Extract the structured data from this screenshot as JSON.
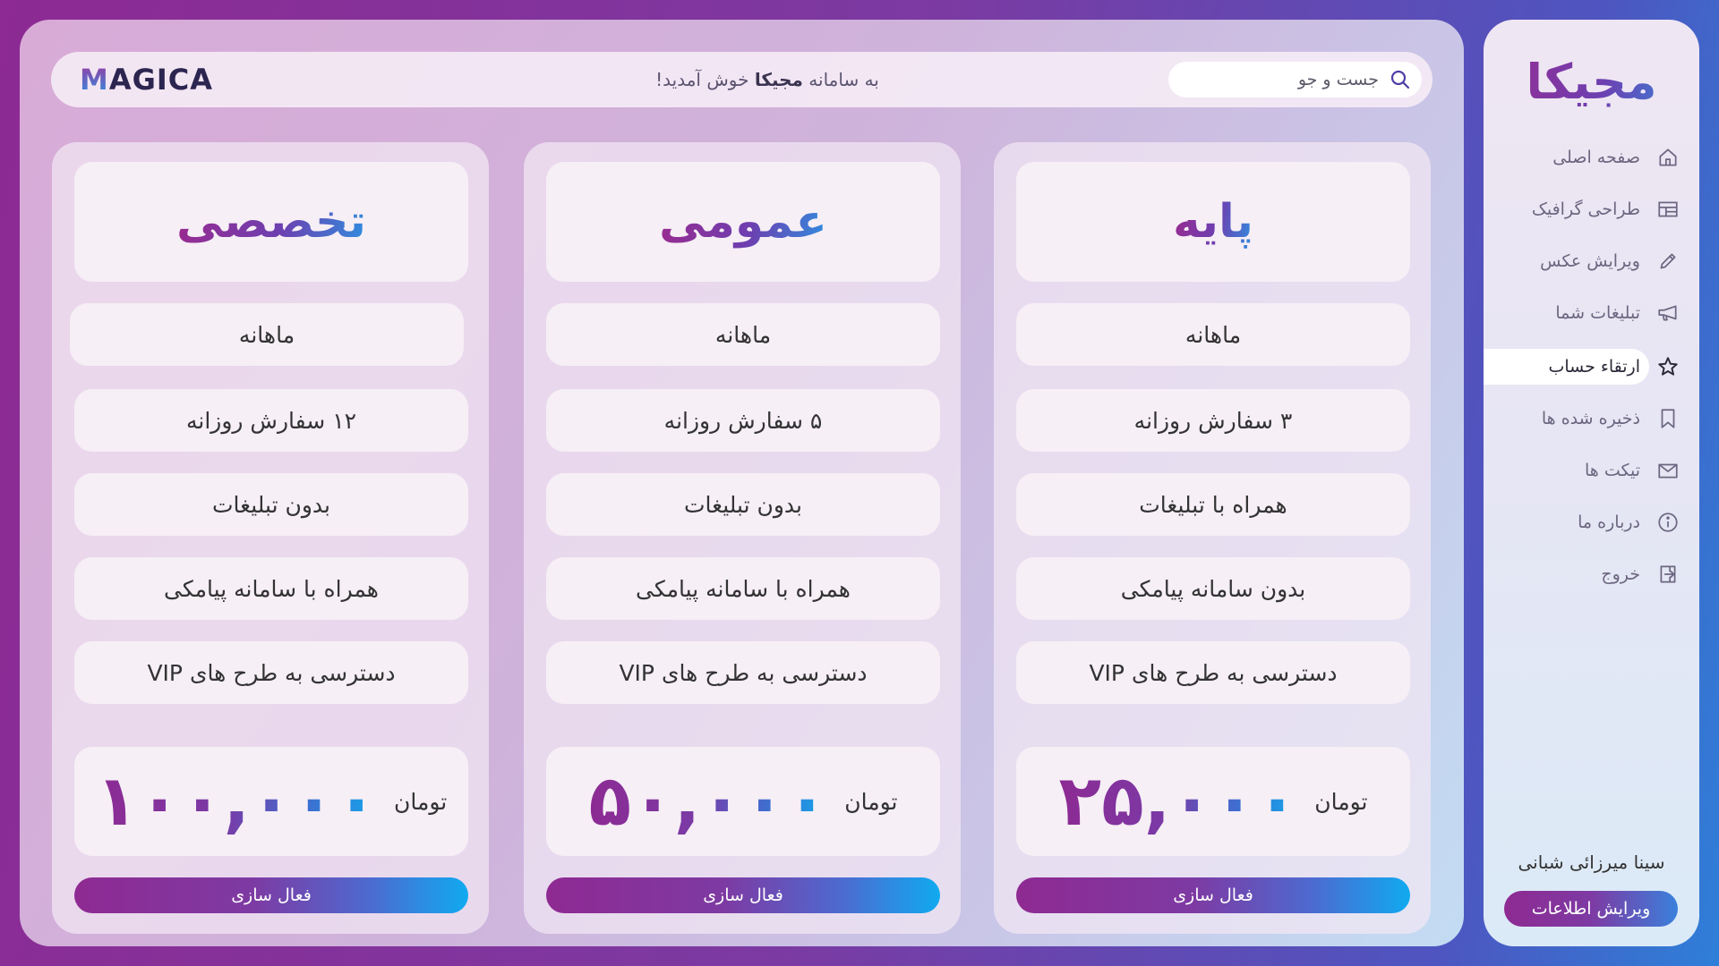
{
  "header": {
    "logo": "MAGICA",
    "welcome_prefix": "به سامانه",
    "welcome_brand": "مجیکا",
    "welcome_suffix": "خوش آمدید!",
    "search_placeholder": "جست و جو"
  },
  "plans": [
    {
      "title": "تخصصی",
      "features": [
        "ماهانه",
        "۱۲ سفارش روزانه",
        "بدون تبلیغات",
        "همراه با سامانه پیامکی",
        "دسترسی به طرح های VIP"
      ],
      "price": "۱۰۰,۰۰۰",
      "currency": "تومان",
      "button": "فعال سازی"
    },
    {
      "title": "عمومی",
      "features": [
        "ماهانه",
        "۵ سفارش روزانه",
        "بدون تبلیغات",
        "همراه با سامانه پیامکی",
        "دسترسی به طرح های VIP"
      ],
      "price": "۵۰,۰۰۰",
      "currency": "تومان",
      "button": "فعال سازی"
    },
    {
      "title": "پایه",
      "features": [
        "ماهانه",
        "۳ سفارش روزانه",
        "همراه با تبلیغات",
        "بدون سامانه پیامکی",
        "دسترسی به طرح های VIP"
      ],
      "price": "۲۵,۰۰۰",
      "currency": "تومان",
      "button": "فعال سازی"
    }
  ],
  "sidebar": {
    "brand": "مجیکا",
    "items": [
      {
        "label": "صفحه اصلی",
        "icon": "home-icon"
      },
      {
        "label": "طراحی گرافیک",
        "icon": "layout-icon"
      },
      {
        "label": "ویرایش عکس",
        "icon": "pencil-icon"
      },
      {
        "label": "تبلیغات شما",
        "icon": "megaphone-icon"
      },
      {
        "label": "ارتقاء حساب",
        "icon": "star-icon",
        "active": true
      },
      {
        "label": "ذخیره شده ها",
        "icon": "bookmark-icon"
      },
      {
        "label": "تیکت ها",
        "icon": "mail-icon"
      },
      {
        "label": "درباره ما",
        "icon": "info-icon"
      },
      {
        "label": "خروج",
        "icon": "logout-icon"
      }
    ],
    "user_name": "سینا میرزائی شبانی",
    "edit_button": "ویرایش اطلاعات"
  },
  "colors": {
    "accent_purple": "#8e2a92",
    "accent_blue": "#10aaf0"
  }
}
